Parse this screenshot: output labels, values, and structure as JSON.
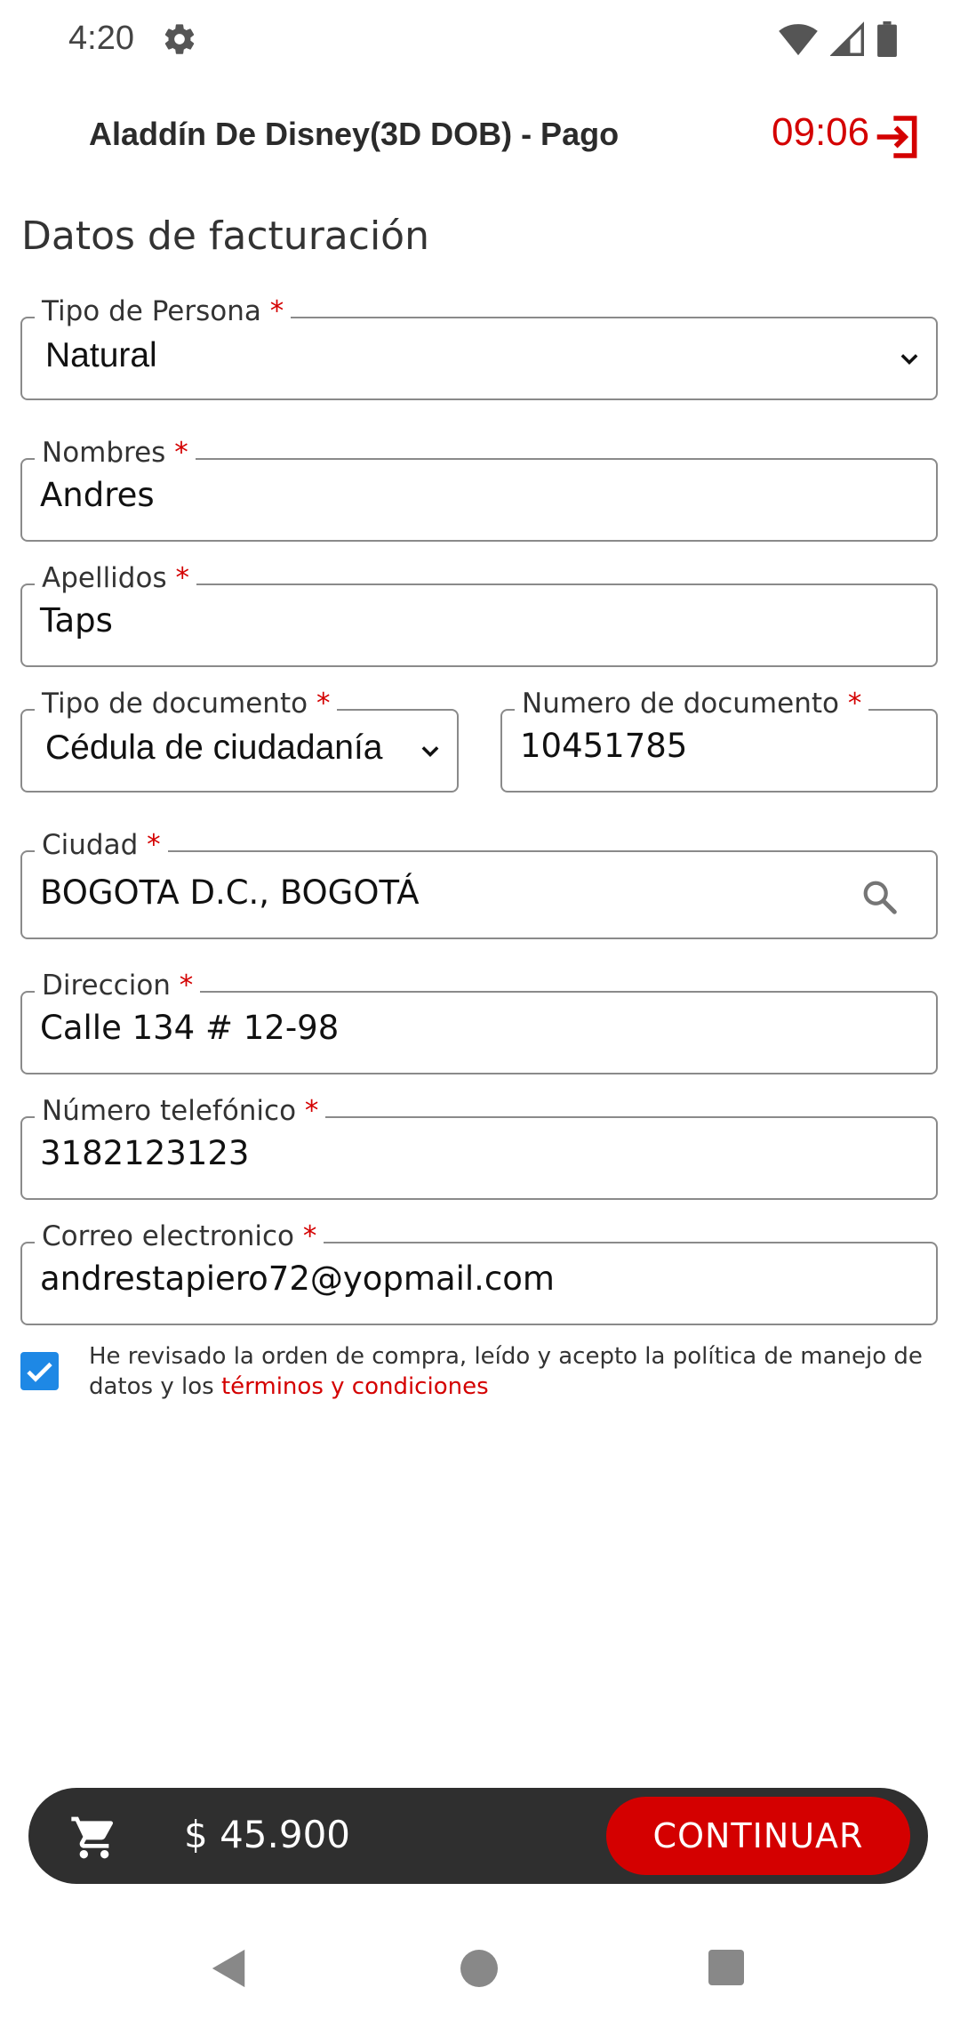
{
  "status_bar": {
    "time": "4:20",
    "icons": [
      "gear-icon",
      "wifi-icon",
      "signal-icon",
      "battery-icon"
    ]
  },
  "header": {
    "title": "Aladdín De Disney(3D DOB) - Pago",
    "timer": "09:06",
    "exit_icon": "exit-icon"
  },
  "section_title": "Datos de facturación",
  "fields": {
    "tipo_persona": {
      "label": "Tipo de Persona",
      "required": "*",
      "value": "Natural"
    },
    "nombres": {
      "label": "Nombres",
      "required": "*",
      "value": "Andres"
    },
    "apellidos": {
      "label": "Apellidos",
      "required": "*",
      "value": "Taps"
    },
    "tipo_documento": {
      "label": "Tipo de documento",
      "required": "*",
      "value": "Cédula de ciudadanía"
    },
    "numero_documento": {
      "label": "Numero de documento",
      "required": "*",
      "value": "10451785"
    },
    "ciudad": {
      "label": "Ciudad",
      "required": "*",
      "value": "BOGOTA D.C., BOGOTÁ"
    },
    "direccion": {
      "label": "Direccion",
      "required": "*",
      "value": "Calle 134 # 12-98"
    },
    "telefono": {
      "label": "Número telefónico",
      "required": "*",
      "value": "3182123123"
    },
    "correo": {
      "label": "Correo electronico",
      "required": "*",
      "value": "andrestapiero72@yopmail.com"
    }
  },
  "terms": {
    "checked": true,
    "text": "He revisado la orden de compra, leído y acepto la política de manejo de datos y los ",
    "link": "términos y condiciones"
  },
  "cart": {
    "total": "$ 45.900",
    "continue_label": "CONTINUAR"
  },
  "colors": {
    "accent": "#d40000",
    "checkbox": "#1e88e5",
    "cart_bar": "#2f2f2f"
  }
}
